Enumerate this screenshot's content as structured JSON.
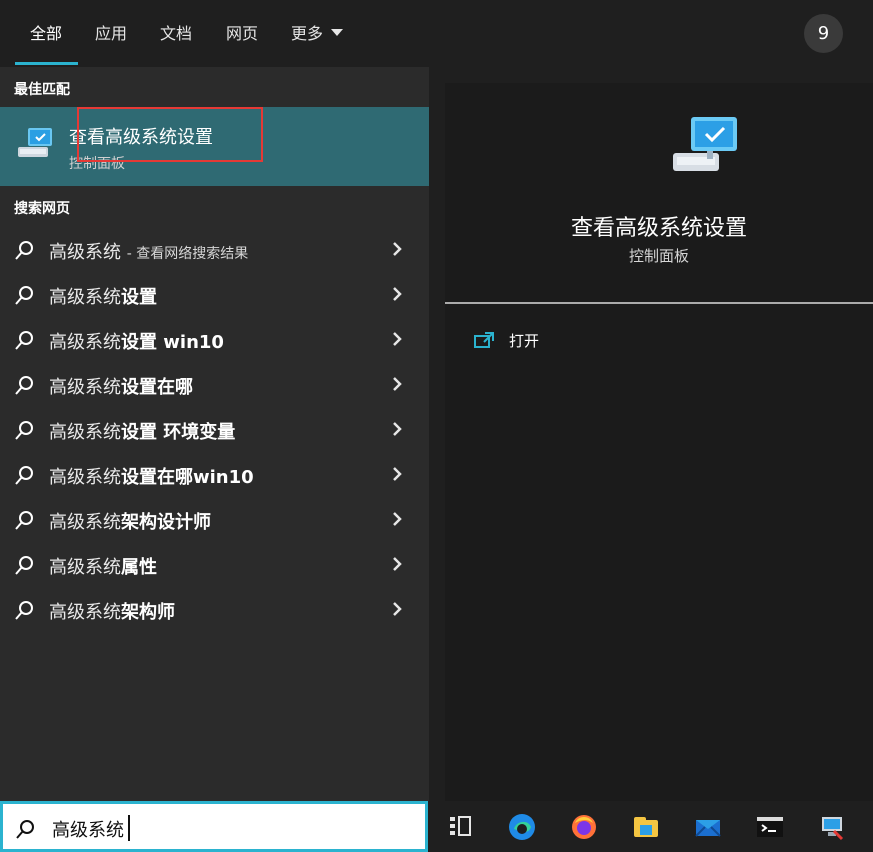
{
  "tabs": {
    "all": "全部",
    "apps": "应用",
    "docs": "文档",
    "web": "网页",
    "more": "更多"
  },
  "badge_count": "9",
  "left_panel": {
    "best_match_title": "最佳匹配",
    "best_match": {
      "title": "查看高级系统设置",
      "subtitle": "控制面板"
    },
    "search_web_title": "搜索网页",
    "results": [
      {
        "prefix": "高级系统",
        "bold": "",
        "suffix": "- 查看网络搜索结果"
      },
      {
        "prefix": "高级系统",
        "bold": "设置",
        "suffix": ""
      },
      {
        "prefix": "高级系统",
        "bold": "设置 win10",
        "suffix": ""
      },
      {
        "prefix": "高级系统",
        "bold": "设置在哪",
        "suffix": ""
      },
      {
        "prefix": "高级系统",
        "bold": "设置 环境变量",
        "suffix": ""
      },
      {
        "prefix": "高级系统",
        "bold": "设置在哪win10",
        "suffix": ""
      },
      {
        "prefix": "高级系统",
        "bold": "架构设计师",
        "suffix": ""
      },
      {
        "prefix": "高级系统",
        "bold": "属性",
        "suffix": ""
      },
      {
        "prefix": "高级系统",
        "bold": "架构师",
        "suffix": ""
      }
    ]
  },
  "right_panel": {
    "title": "查看高级系统设置",
    "subtitle": "控制面板",
    "open_label": "打开"
  },
  "search": {
    "value": "高级系统"
  },
  "colors": {
    "accent": "#2bb3cf",
    "selected_bg": "#2f6a73",
    "highlight_box": "#e53935"
  },
  "icons": {
    "search": "search-icon",
    "chevron": "chevron-right-icon",
    "open": "open-external-icon",
    "control_panel": "control-panel-icon"
  }
}
